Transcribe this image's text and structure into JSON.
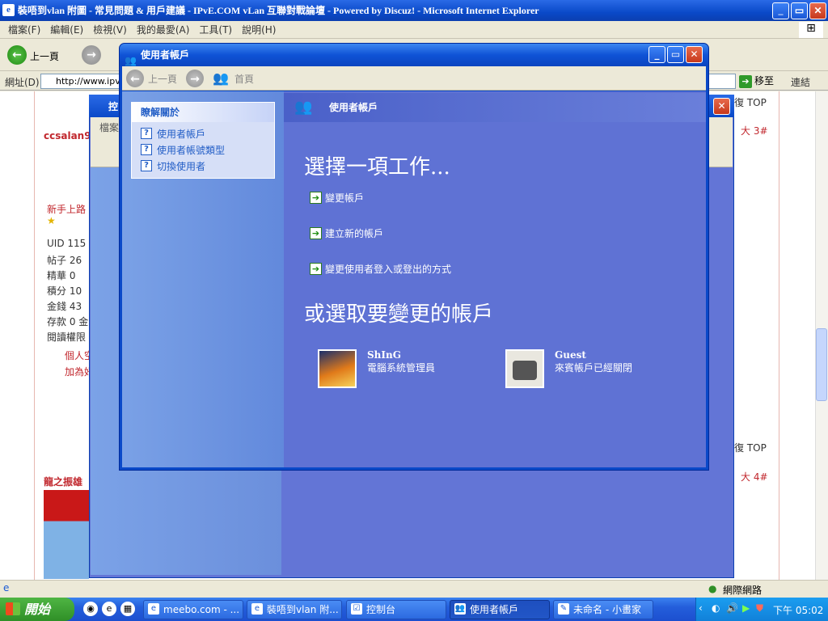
{
  "ie": {
    "title": "裝唔到vlan 附圖 - 常見問題 & 用戶建議 - IPvE.COM vLan 互聯對戰論壇 - Powered by Discuz! - Microsoft Internet Explorer",
    "menu": [
      "檔案(F)",
      "編輯(E)",
      "檢視(V)",
      "我的最愛(A)",
      "工具(T)",
      "說明(H)"
    ],
    "back_label": "上一頁",
    "address_label": "網址(D)",
    "address_value": "http://www.ipve",
    "go_label": "移至",
    "links_label": "連結",
    "status_zone": "網際網路"
  },
  "forum": {
    "reply_top_1": "復 TOP",
    "floor_3": "大  3#",
    "user1": "ccsalan92",
    "rank": "新手上路",
    "stats": [
      "UID  115",
      "帖子  26",
      "精華  0",
      "積分  10",
      "金錢  43",
      "存款  0 金",
      "閱讀權限"
    ],
    "link1": "個人空",
    "link2": "加為好",
    "reply_top_2": "復 TOP",
    "floor_4": "大  4#",
    "user2": "龍之振雄"
  },
  "cp": {
    "title": "控",
    "menu_first": "檔案"
  },
  "ua": {
    "title": "使用者帳戶",
    "back_label": "上一頁",
    "home_label": "首頁",
    "learn_title": "瞭解關於",
    "learn_items": [
      "使用者帳戶",
      "使用者帳號類型",
      "切換使用者"
    ],
    "header": "使用者帳戶",
    "pick_task": "選擇一項工作...",
    "tasks": [
      "變更帳戶",
      "建立新的帳戶",
      "變更使用者登入或登出的方式"
    ],
    "pick_account": "或選取要變更的帳戶",
    "accounts": [
      {
        "name": "ShInG",
        "desc": "電腦系統管理員"
      },
      {
        "name": "Guest",
        "desc": "來賓帳戶已經關閉"
      }
    ]
  },
  "taskbar": {
    "start": "開始",
    "buttons": [
      "meebo.com - ...",
      "裝唔到vlan 附...",
      "控制台",
      "使用者帳戶",
      "未命名 - 小畫家"
    ],
    "clock": "下午 05:02"
  }
}
